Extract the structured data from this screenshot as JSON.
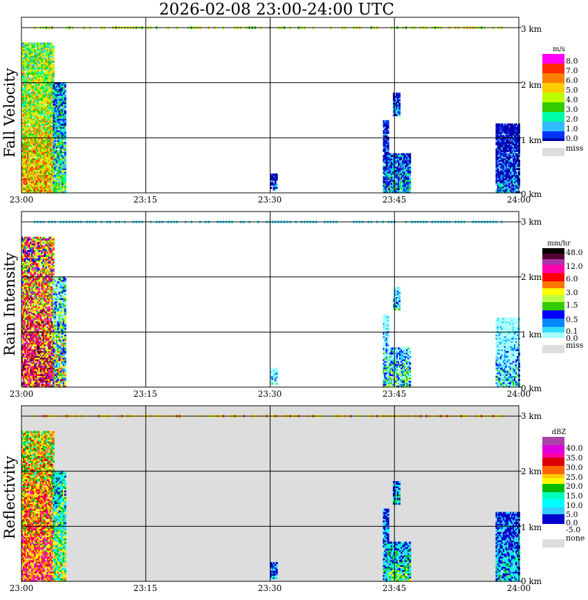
{
  "title": "2026-02-08   23:00-24:00 UTC",
  "colors": {
    "missing": "#dddddd",
    "grid": "#000000"
  },
  "chart_data": [
    {
      "type": "heatmap",
      "ylabel": "Fall Velocity",
      "x_ticks": [
        "23:00",
        "23:15",
        "23:30",
        "23:45",
        "24:00"
      ],
      "y_ticks": [
        "0 km",
        "1 km",
        "2 km",
        "3 km"
      ],
      "ylim_km": [
        0,
        3.2
      ],
      "legend": {
        "unit": "m/s",
        "labels": [
          "8.0",
          "7.0",
          "6.0",
          "5.0",
          "4.0",
          "3.0",
          "2.0",
          "1.0",
          "0.0"
        ],
        "colors": [
          "#ff00ff",
          "#ff2a00",
          "#ff7f00",
          "#ffcc00",
          "#bbff00",
          "#33cc00",
          "#00ffaa",
          "#33bbff",
          "#0033ff",
          "#0000aa"
        ],
        "missing_label": "miss"
      }
    },
    {
      "type": "heatmap",
      "ylabel": "Rain Intensity",
      "x_ticks": [
        "23:00",
        "23:15",
        "23:30",
        "23:45",
        "24:00"
      ],
      "y_ticks": [
        "0 km",
        "1 km",
        "2 km",
        "3 km"
      ],
      "ylim_km": [
        0,
        3.2
      ],
      "legend": {
        "unit": "mm/hr",
        "labels": [
          "48.0",
          "12.0",
          "6.0",
          "3.0",
          "1.5",
          "0.5",
          "0.1",
          "0.0"
        ],
        "colors": [
          "#000000",
          "#550033",
          "#aa33aa",
          "#ff00aa",
          "#ff0000",
          "#ff7700",
          "#ffff00",
          "#bbff44",
          "#33cc00",
          "#0000ff",
          "#0088ff",
          "#33ddff",
          "#aaffff",
          "#ffffff"
        ],
        "missing_label": "miss"
      }
    },
    {
      "type": "heatmap",
      "ylabel": "Reflectivity",
      "x_ticks": [
        "23:00",
        "23:15",
        "23:30",
        "23:45",
        "24:00"
      ],
      "y_ticks": [
        "0 km",
        "1 km",
        "2 km",
        "3 km"
      ],
      "ylim_km": [
        0,
        3.2
      ],
      "legend": {
        "unit": "dBZ",
        "labels": [
          "40.0",
          "35.0",
          "30.0",
          "25.0",
          "20.0",
          "15.0",
          "10.0",
          "5.0",
          "0.0",
          "-5.0"
        ],
        "colors": [
          "#aa44aa",
          "#dd00dd",
          "#ff00aa",
          "#dd0000",
          "#ff6600",
          "#ffcc00",
          "#ffff00",
          "#00bb00",
          "#00ffbb",
          "#00ffff",
          "#33ccff",
          "#0000cc"
        ],
        "missing_label": "none"
      }
    }
  ]
}
